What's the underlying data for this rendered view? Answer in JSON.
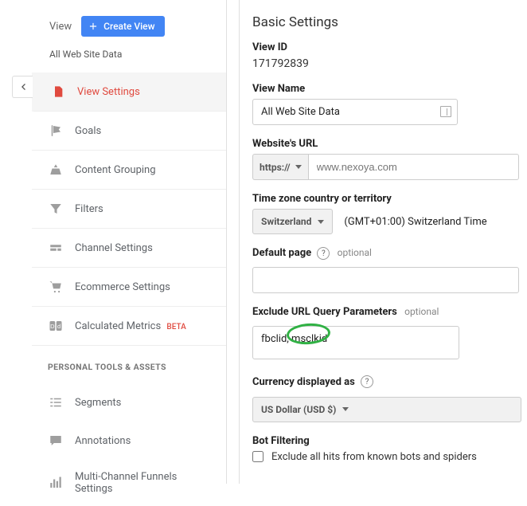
{
  "colors": {
    "accent": "#4285F4",
    "active": "#E04A3F"
  },
  "back": {
    "aria": "Back"
  },
  "viewHeader": {
    "label": "View",
    "createBtn": "Create View"
  },
  "subheader": "All Web Site Data",
  "nav": [
    {
      "label": "View Settings"
    },
    {
      "label": "Goals"
    },
    {
      "label": "Content Grouping"
    },
    {
      "label": "Filters"
    },
    {
      "label": "Channel Settings"
    },
    {
      "label": "Ecommerce Settings"
    },
    {
      "label": "Calculated Metrics",
      "badge": "BETA"
    }
  ],
  "personalSection": "PERSONAL TOOLS & ASSETS",
  "personalNav": [
    {
      "label": "Segments"
    },
    {
      "label": "Annotations"
    },
    {
      "label": "Multi-Channel Funnels\nSettings"
    }
  ],
  "basic": {
    "heading": "Basic Settings",
    "viewIdLabel": "View ID",
    "viewId": "171792839",
    "viewNameLabel": "View Name",
    "viewName": "All Web Site Data",
    "websiteUrlLabel": "Website's URL",
    "protocol": "https://",
    "websiteUrl": "www.nexoya.com",
    "tzLabel": "Time zone country or territory",
    "tzCountry": "Switzerland",
    "tzDisplay": "(GMT+01:00) Switzerland Time",
    "defaultPageLabel": "Default page",
    "optional": "optional",
    "defaultPage": "",
    "excludeLabel": "Exclude URL Query Parameters",
    "excludeValue": "fbclid, msclkid",
    "currencyLabel": "Currency displayed as",
    "currencyValue": "US Dollar (USD $)",
    "botLabel": "Bot Filtering",
    "botCheckbox": "Exclude all hits from known bots and spiders"
  }
}
